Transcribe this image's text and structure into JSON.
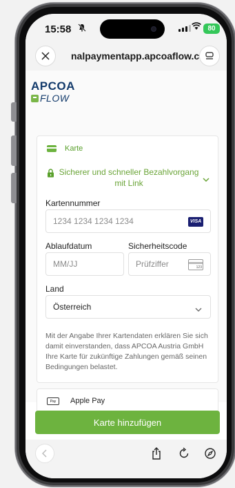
{
  "status": {
    "time": "15:58",
    "battery": "80"
  },
  "browser": {
    "url": "nalpaymentapp.apcoaflow.com"
  },
  "logo": {
    "top": "APCOA",
    "bottom": "FLOW"
  },
  "payment": {
    "method_label": "Karte",
    "link_text": "Sicherer und schneller Bezahlvorgang mit Link",
    "card_number_label": "Kartennummer",
    "card_number_placeholder": "1234 1234 1234 1234",
    "card_brand": "VISA",
    "expiry_label": "Ablaufdatum",
    "expiry_placeholder": "MM/JJ",
    "cvc_label": "Sicherheitscode",
    "cvc_placeholder": "Prüfziffer",
    "cvc_icon_text": "123",
    "country_label": "Land",
    "country_value": "Österreich",
    "consent_text": "Mit der Angabe Ihrer Kartendaten erklären Sie sich damit einverstanden, dass APCOA Austria GmbH Ihre Karte für zukünftige Zahlungen gemäß seinen Bedingungen belastet.",
    "apple_pay_icon": "Pay",
    "apple_pay_label": "Apple Pay"
  },
  "actions": {
    "add_card": "Karte hinzufügen"
  },
  "colors": {
    "accent": "#6db33f",
    "brand": "#123a6b"
  }
}
